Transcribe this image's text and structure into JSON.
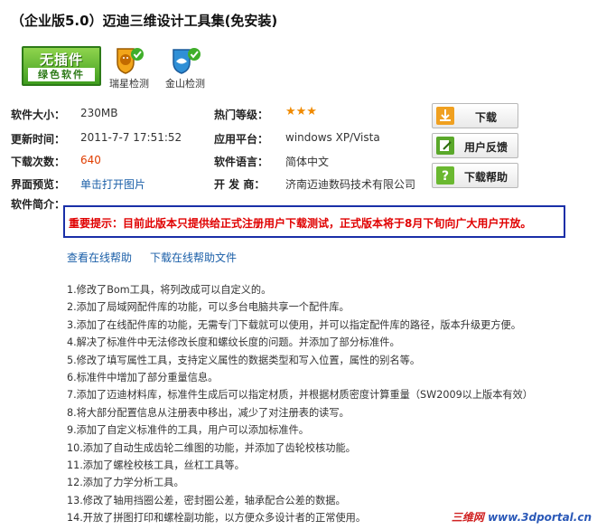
{
  "title": "（企业版5.0）迈迪三维设计工具集(免安装)",
  "badges": {
    "nopatch_line1": "无插件",
    "nopatch_line2": "绿色软件",
    "rising_label": "瑞星检测",
    "kingsoft_label": "金山检测"
  },
  "info": {
    "size_label": "软件大小：",
    "size_value": "230MB",
    "update_label": "更新时间：",
    "update_value": "2011-7-7 17:51:52",
    "downloads_label": "下载次数：",
    "downloads_value": "640",
    "preview_label": "界面预览：",
    "preview_value": "单击打开图片",
    "intro_label": "软件简介：",
    "rating_label": "热门等级：",
    "rating_stars": 3,
    "platform_label": "应用平台：",
    "platform_value": "windows XP/Vista",
    "language_label": "软件语言：",
    "language_value": "简体中文",
    "developer_label": "开 发 商：",
    "developer_value": "济南迈迪数码技术有限公司"
  },
  "buttons": {
    "download": "下载",
    "feedback": "用户反馈",
    "help": "下载帮助"
  },
  "notice": {
    "key": "重要提示：",
    "text": "目前此版本只提供给正式注册用户下载测试，正式版本将于8月下旬向广大用户开放。"
  },
  "help_links": {
    "online": "查看在线帮助",
    "download": "下载在线帮助文件"
  },
  "changelog": [
    "1.修改了Bom工具，将列改成可以自定义的。",
    "2.添加了局域网配件库的功能，可以多台电脑共享一个配件库。",
    "3.添加了在线配件库的功能，无需专门下载就可以使用，并可以指定配件库的路径，版本升级更方便。",
    "4.解决了标准件中无法修改长度和螺纹长度的问题。并添加了部分标准件。",
    "5.修改了填写属性工具，支持定义属性的数据类型和写入位置，属性的别名等。",
    "6.标准件中增加了部分重量信息。",
    "7.添加了迈迪材料库，标准件生成后可以指定材质，并根据材质密度计算重量（SW2009以上版本有效）",
    "8.将大部分配置信息从注册表中移出，减少了对注册表的读写。",
    "9.添加了自定义标准件的工具，用户可以添加标准件。",
    "10.添加了自动生成齿轮二维图的功能，并添加了齿轮校核功能。",
    "11.添加了螺栓校核工具，丝杠工具等。",
    "12.添加了力学分析工具。",
    "13.修改了轴用挡圈公差，密封圈公差，轴承配合公差的数据。",
    "14.开放了拼图打印和螺栓副功能，以方便众多设计者的正常使用。"
  ],
  "watermark": {
    "part1": "三维网",
    "part2": "www.3dportal.cn"
  },
  "colors": {
    "notice_border": "#1a2fa8",
    "notice_text": "#e00000",
    "link": "#1b5fa8",
    "badge_green": "#3f9d1e",
    "star": "#f08a00"
  }
}
